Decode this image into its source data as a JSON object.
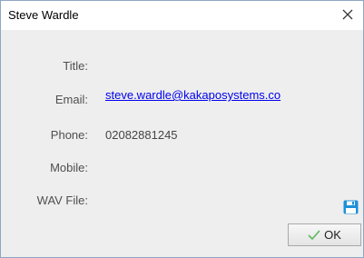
{
  "window": {
    "title": "Steve Wardle"
  },
  "fields": {
    "title_label": "Title:",
    "title_value": "",
    "email_label": "Email:",
    "email_value": "steve.wardle@kakaposystems.co",
    "phone_label": "Phone:",
    "phone_value": "02082881245",
    "mobile_label": "Mobile:",
    "mobile_value": "",
    "wav_label": "WAV File:",
    "wav_value": ""
  },
  "buttons": {
    "ok_label": "OK"
  },
  "icons": {
    "close": "close-icon",
    "save": "floppy-disk-icon",
    "ok": "checkmark-icon"
  },
  "colors": {
    "link": "#0000ee",
    "save_icon": "#1e90d8",
    "check": "#5cb85c"
  }
}
